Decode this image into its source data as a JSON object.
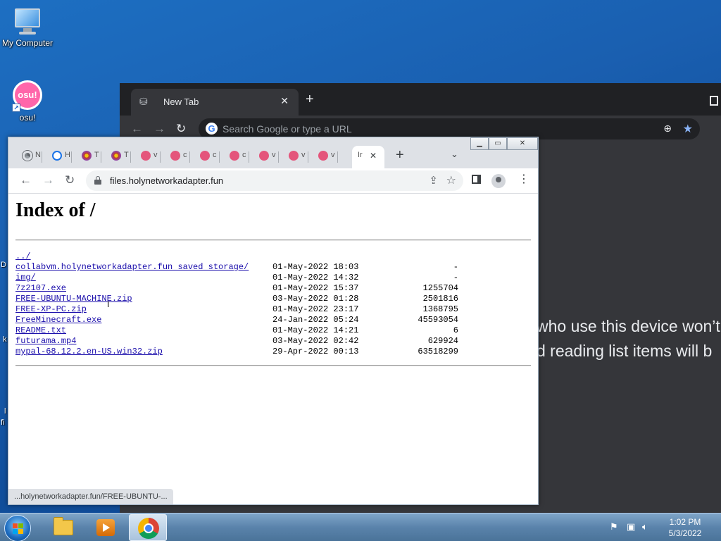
{
  "desktop": {
    "icons": [
      {
        "label": "My Computer",
        "icon": "computer-icon"
      },
      {
        "label": "osu!",
        "icon": "osu-icon",
        "badge": "osu!"
      }
    ],
    "edge_letters": [
      "D",
      "k",
      "l",
      "fi"
    ]
  },
  "bg_browser": {
    "tab_title": "New Tab",
    "tab_close": "✕",
    "new_tab": "+",
    "omnibox_placeholder": "Search Google or type a URL",
    "google_g": "G",
    "content_line1": "who use this device won’t",
    "content_line2": "d reading list items will b"
  },
  "fg_browser": {
    "window_controls": {
      "minimize": "▁",
      "maximize": "▭",
      "close": "✕"
    },
    "tabs": [
      {
        "label": "N",
        "icon": "chrome-icon",
        "color": "#5f6368"
      },
      {
        "label": "H",
        "icon": "history-icon",
        "color": "#1a73e8"
      },
      {
        "label": "T",
        "icon": "flower-icon",
        "color": "#c0392b"
      },
      {
        "label": "T",
        "icon": "flower-icon",
        "color": "#c0392b"
      },
      {
        "label": "v",
        "icon": "osu-favicon",
        "color": "#e4557b"
      },
      {
        "label": "c",
        "icon": "osu-favicon",
        "color": "#e4557b"
      },
      {
        "label": "c",
        "icon": "osu-favicon",
        "color": "#e4557b"
      },
      {
        "label": "c",
        "icon": "osu-favicon",
        "color": "#e4557b"
      },
      {
        "label": "v",
        "icon": "osu-favicon",
        "color": "#e4557b"
      },
      {
        "label": "v",
        "icon": "osu-favicon",
        "color": "#e4557b"
      },
      {
        "label": "v",
        "icon": "osu-favicon",
        "color": "#e4557b"
      },
      {
        "label": "Ir",
        "icon": "none",
        "color": "#000000",
        "active": true
      }
    ],
    "active_tab_close": "✕",
    "new_tab": "+",
    "tab_search": "⌄",
    "url": "files.holynetworkadapter.fun",
    "status_url": "...holynetworkadapter.fun/FREE-UBUNTU-..."
  },
  "page": {
    "heading": "Index of /",
    "entries": [
      {
        "name": "../",
        "date": "",
        "size": ""
      },
      {
        "name": "collabvm.holynetworkadapter.fun saved storage/",
        "date": "01-May-2022 18:03",
        "size": "-"
      },
      {
        "name": "img/",
        "date": "01-May-2022 14:32",
        "size": "-"
      },
      {
        "name": "7z2107.exe",
        "date": "01-May-2022 15:37",
        "size": "1255704"
      },
      {
        "name": "FREE-UBUNTU-MACHINE.zip",
        "date": "03-May-2022 01:28",
        "size": "2501816"
      },
      {
        "name": "FREE-XP-PC.zip",
        "date": "01-May-2022 23:17",
        "size": "1368795"
      },
      {
        "name": "FreeMinecraft.exe",
        "date": "24-Jan-2022 05:24",
        "size": "45593054"
      },
      {
        "name": "README.txt",
        "date": "01-May-2022 14:21",
        "size": "6"
      },
      {
        "name": "futurama.mp4",
        "date": "03-May-2022 02:42",
        "size": "629924"
      },
      {
        "name": "mypal-68.12.2.en-US.win32.zip",
        "date": "29-Apr-2022 00:13",
        "size": "63518299"
      }
    ]
  },
  "taskbar": {
    "apps": [
      {
        "name": "windows-explorer",
        "icon": "folder-icon"
      },
      {
        "name": "media-player",
        "icon": "media-player-icon"
      },
      {
        "name": "google-chrome",
        "icon": "chrome-icon",
        "active": true
      }
    ],
    "clock_time": "1:02 PM",
    "clock_date": "5/3/2022"
  }
}
